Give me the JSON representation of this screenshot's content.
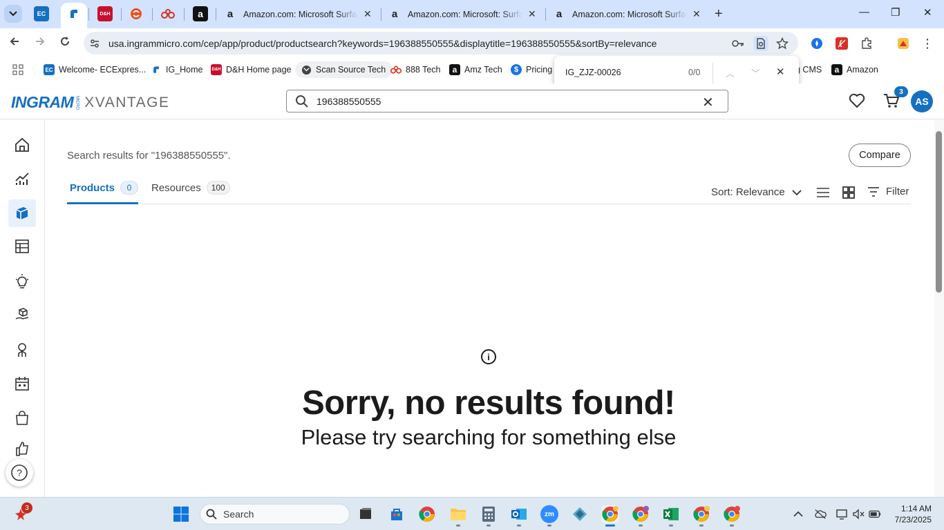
{
  "browser": {
    "tabs": [
      {
        "title": "Amazon.com: Microsoft Surface",
        "close": "✕"
      },
      {
        "title": "Amazon.com: Microsoft: Surface",
        "close": "✕"
      },
      {
        "title": "Amazon.com: Microsoft Surface",
        "close": "✕"
      }
    ],
    "new_tab": "+",
    "small_tab_labels": {
      "ec": "EC"
    },
    "window_controls": {
      "minimize": "—",
      "maximize": "❐",
      "close": "✕"
    },
    "url": "usa.ingrammicro.com/cep/app/product/productsearch?keywords=196388550555&displaytitle=196388550555&sortBy=relevance",
    "bookmarks": [
      {
        "label": "Welcome- ECExpres...",
        "icon_text": "EC",
        "color": "#1570c1"
      },
      {
        "label": "IG_Home",
        "icon_text": "",
        "color": "#1570c1"
      },
      {
        "label": "D&H Home page",
        "icon_text": "D&H",
        "color": "#c8102e"
      },
      {
        "label": "Scan Source Tech",
        "icon_text": "",
        "color": "#444444"
      },
      {
        "label": "888 Tech",
        "icon_text": "",
        "color": "#d93025"
      },
      {
        "label": "Amz Tech",
        "icon_text": "a",
        "color": "#111111"
      },
      {
        "label": "Pricing",
        "icon_text": "$",
        "color": "#1a73e8"
      },
      {
        "label": "g CMS",
        "icon_text": "",
        "color": ""
      },
      {
        "label": "Amazon",
        "icon_text": "a",
        "color": "#111111"
      }
    ],
    "find": {
      "query": "IG_ZJZ-00026",
      "count": "0/0",
      "prev": "︿",
      "next": "﹀",
      "close": "✕"
    }
  },
  "header": {
    "logo_ingram": "INGRAM",
    "logo_micro": "MICRO",
    "logo_xvantage": "XVANTAGE",
    "search_value": "196388550555",
    "clear": "✕",
    "cart_count": "3",
    "avatar": "AS"
  },
  "main": {
    "results_text": "Search results for \"196388550555\".",
    "compare": "Compare",
    "tabs": [
      {
        "label": "Products",
        "count": "0"
      },
      {
        "label": "Resources",
        "count": "100"
      }
    ],
    "sort": "Sort: Relevance",
    "filter": "Filter",
    "empty_title": "Sorry, no results found!",
    "empty_sub": "Please try searching for something else",
    "info_glyph": "i"
  },
  "rail": {
    "help": "?"
  },
  "taskbar": {
    "search": "Search",
    "time": "1:14 AM",
    "date": "7/23/2025",
    "notif_count": "3",
    "zoom_label": "zm"
  },
  "colors": {
    "brand": "#1570c1",
    "tabstrip": "#d3e3fd",
    "taskbar": "#dde8f2"
  }
}
